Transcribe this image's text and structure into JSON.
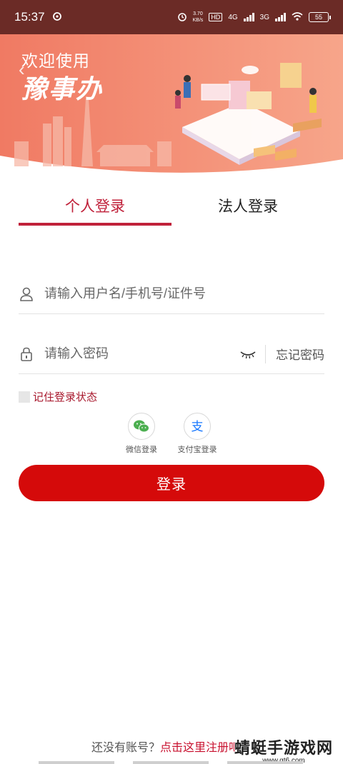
{
  "status_bar": {
    "time": "15:37",
    "speed_value": "3.70",
    "speed_unit": "KB/s",
    "hd": "HD",
    "network_1": "4G",
    "network_2": "3G",
    "battery": "55"
  },
  "banner": {
    "welcome": "欢迎使用",
    "app_name": "豫事办"
  },
  "tabs": [
    {
      "label": "个人登录",
      "active": true
    },
    {
      "label": "法人登录",
      "active": false
    }
  ],
  "form": {
    "username_placeholder": "请输入用户名/手机号/证件号",
    "password_placeholder": "请输入密码",
    "forgot_password": "忘记密码",
    "remember_label": "记住登录状态"
  },
  "social_login": [
    {
      "label": "微信登录",
      "icon": "wechat-icon",
      "color": "#4caf50"
    },
    {
      "label": "支付宝登录",
      "icon": "alipay-icon",
      "color": "#1677ff"
    }
  ],
  "login_button": "登录",
  "register": {
    "prompt": "还没有账号？",
    "link": "点击这里注册吧"
  },
  "watermark": {
    "title": "蜻蜓手游戏网",
    "url": "www.qt6.com"
  },
  "colors": {
    "accent": "#c0213a",
    "button": "#d50a0a",
    "status_bar": "#6b2b26",
    "banner": "#f28b72"
  }
}
